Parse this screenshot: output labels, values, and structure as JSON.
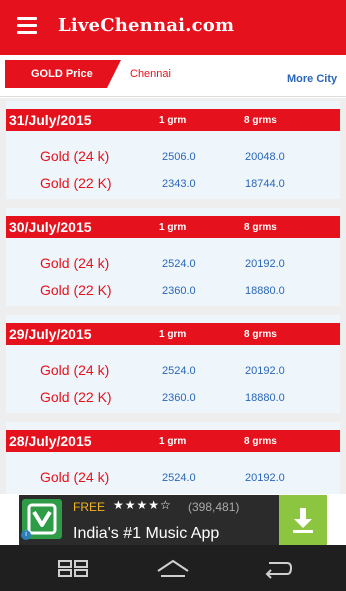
{
  "header": {
    "title": "LiveChennai.com"
  },
  "tabs": {
    "gold_label": "GOLD Price",
    "city_label": "Chennai",
    "more_city": "More City"
  },
  "table": {
    "col1": "1 grm",
    "col2": "8 grms",
    "entries": [
      {
        "date": "31/July/2015",
        "rows": [
          {
            "label": "Gold (24 k)",
            "v1": "2506.0",
            "v2": "20048.0"
          },
          {
            "label": "Gold (22 K)",
            "v1": "2343.0",
            "v2": "18744.0"
          }
        ]
      },
      {
        "date": "30/July/2015",
        "rows": [
          {
            "label": "Gold (24 k)",
            "v1": "2524.0",
            "v2": "20192.0"
          },
          {
            "label": "Gold (22 K)",
            "v1": "2360.0",
            "v2": "18880.0"
          }
        ]
      },
      {
        "date": "29/July/2015",
        "rows": [
          {
            "label": "Gold (24 k)",
            "v1": "2524.0",
            "v2": "20192.0"
          },
          {
            "label": "Gold (22 K)",
            "v1": "2360.0",
            "v2": "18880.0"
          }
        ]
      },
      {
        "date": "28/July/2015",
        "rows": [
          {
            "label": "Gold (24 k)",
            "v1": "2524.0",
            "v2": "20192.0"
          }
        ]
      }
    ]
  },
  "ad": {
    "free": "FREE",
    "stars": "★★★★☆",
    "rating_count": "(398,481)",
    "title": "India's #1 Music App",
    "info": "i"
  },
  "colors": {
    "brand": "#e5121d",
    "value": "#2a66b8",
    "ad_accent": "#8cc53f"
  },
  "icons": {
    "menu": "hamburger-icon",
    "recents": "recent-apps-icon",
    "home": "home-icon",
    "back": "back-icon",
    "download": "download-icon",
    "app": "saavn-app-icon"
  }
}
